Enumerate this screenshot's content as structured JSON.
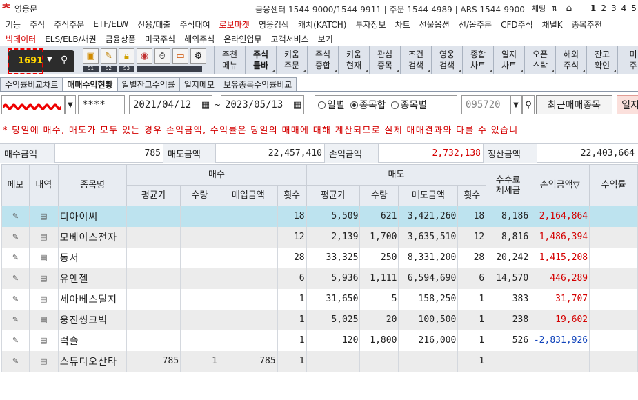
{
  "titlebar": {
    "app_name": "영웅문",
    "contacts": "금융센터 1544-9000/1544-9911 | 주문 1544-4989 | ARS 1544-9900",
    "chat_label": "채팅",
    "pages": [
      "1",
      "2",
      "3",
      "4",
      "5"
    ],
    "active_page": "1"
  },
  "menu_row1": [
    "기능",
    "주식",
    "주식주문",
    "ETF/ELW",
    "신용/대출",
    "주식대여",
    "로보마켓",
    "영웅검색",
    "캐치(KATCH)",
    "투자정보",
    "차트",
    "선물옵션",
    "선/옵주문",
    "CFD주식",
    "채널K",
    "종목추천"
  ],
  "menu_row1_red": [
    "로보마켓"
  ],
  "menu_row2": [
    "빅데이터",
    "ELS/ELB/채권",
    "금융상품",
    "미국주식",
    "해외주식",
    "온라인업무",
    "고객서비스",
    "보기"
  ],
  "menu_row2_red": [
    "빅데이터"
  ],
  "toolbar": {
    "screen_code": "1691",
    "slots": [
      "S1",
      "S2",
      "S3"
    ],
    "tools": [
      {
        "l1": "추천",
        "l2": "메뉴",
        "bold": false
      },
      {
        "l1": "주식",
        "l2": "툴바",
        "bold": true
      },
      {
        "l1": "키움",
        "l2": "주문",
        "bold": false
      },
      {
        "l1": "주식",
        "l2": "종합",
        "bold": false
      },
      {
        "l1": "키움",
        "l2": "현재",
        "bold": false
      },
      {
        "l1": "관심",
        "l2": "종목",
        "bold": false
      },
      {
        "l1": "조건",
        "l2": "검색",
        "bold": false
      },
      {
        "l1": "영웅",
        "l2": "검색",
        "bold": false
      },
      {
        "l1": "종합",
        "l2": "차트",
        "bold": false
      },
      {
        "l1": "일지",
        "l2": "차트",
        "bold": false
      },
      {
        "l1": "오픈",
        "l2": "스탁",
        "bold": false
      },
      {
        "l1": "해외",
        "l2": "주식",
        "bold": false
      },
      {
        "l1": "잔고",
        "l2": "확인",
        "bold": false
      },
      {
        "l1": "미",
        "l2": "주",
        "bold": false
      }
    ]
  },
  "tabs": [
    "수익률비교차트",
    "매매수익현황",
    "일별잔고수익률",
    "일지메모",
    "보유종목수익률비교"
  ],
  "active_tab": "매매수익현황",
  "filter": {
    "password": "****",
    "date_from": "2021/04/12",
    "date_to": "2023/05/13",
    "tilde": "~",
    "radios": [
      {
        "label": "일별",
        "on": false
      },
      {
        "label": "종목합",
        "on": true
      },
      {
        "label": "종목별",
        "on": false
      }
    ],
    "stock_code": "095720",
    "recent_button": "최근매매종목",
    "query_button": "일지"
  },
  "notice": "* 당일에 매수, 매도가 모두 있는 경우 손익금액, 수익률은 당일의 매매에 대해 계산되므로 실제 매매결과와 다를 수 있습니",
  "summary": {
    "buy_label": "매수금액",
    "buy_value": "785",
    "sell_label": "매도금액",
    "sell_value": "22,457,410",
    "pnl_label": "손익금액",
    "pnl_value": "2,732,138",
    "settle_label": "정산금액",
    "settle_value": "22,403,664"
  },
  "table": {
    "headers": {
      "memo": "메모",
      "detail": "내역",
      "name": "종목명",
      "buy_group": "매수",
      "sell_group": "매도",
      "buy_avg": "평균가",
      "buy_qty": "수량",
      "buy_amount": "매입금액",
      "buy_count": "횟수",
      "sell_avg": "평균가",
      "sell_qty": "수량",
      "sell_amount": "매도금액",
      "sell_count": "횟수",
      "fee_l1": "수수료",
      "fee_l2": "제세금",
      "pnl": "손익금액▽",
      "rate": "수익률"
    },
    "rows": [
      {
        "name": "디아이씨",
        "buy_avg": "",
        "buy_qty": "",
        "buy_amount": "",
        "buy_count": "18",
        "sell_avg": "5,509",
        "sell_qty": "621",
        "sell_amount": "3,421,260",
        "sell_count": "18",
        "fee": "8,186",
        "pnl": "2,164,864",
        "pnl_color": "red",
        "rate": ""
      },
      {
        "name": "모베이스전자",
        "buy_avg": "",
        "buy_qty": "",
        "buy_amount": "",
        "buy_count": "12",
        "sell_avg": "2,139",
        "sell_qty": "1,700",
        "sell_amount": "3,635,510",
        "sell_count": "12",
        "fee": "8,816",
        "pnl": "1,486,394",
        "pnl_color": "red",
        "rate": ""
      },
      {
        "name": "동서",
        "buy_avg": "",
        "buy_qty": "",
        "buy_amount": "",
        "buy_count": "28",
        "sell_avg": "33,325",
        "sell_qty": "250",
        "sell_amount": "8,331,200",
        "sell_count": "28",
        "fee": "20,242",
        "pnl": "1,415,208",
        "pnl_color": "red",
        "rate": ""
      },
      {
        "name": "유엔젤",
        "buy_avg": "",
        "buy_qty": "",
        "buy_amount": "",
        "buy_count": "6",
        "sell_avg": "5,936",
        "sell_qty": "1,111",
        "sell_amount": "6,594,690",
        "sell_count": "6",
        "fee": "14,570",
        "pnl": "446,289",
        "pnl_color": "red",
        "rate": ""
      },
      {
        "name": "세아베스틸지",
        "buy_avg": "",
        "buy_qty": "",
        "buy_amount": "",
        "buy_count": "1",
        "sell_avg": "31,650",
        "sell_qty": "5",
        "sell_amount": "158,250",
        "sell_count": "1",
        "fee": "383",
        "pnl": "31,707",
        "pnl_color": "red",
        "rate": ""
      },
      {
        "name": "웅진씽크빅",
        "buy_avg": "",
        "buy_qty": "",
        "buy_amount": "",
        "buy_count": "1",
        "sell_avg": "5,025",
        "sell_qty": "20",
        "sell_amount": "100,500",
        "sell_count": "1",
        "fee": "238",
        "pnl": "19,602",
        "pnl_color": "red",
        "rate": ""
      },
      {
        "name": "럭슬",
        "buy_avg": "",
        "buy_qty": "",
        "buy_amount": "",
        "buy_count": "1",
        "sell_avg": "120",
        "sell_qty": "1,800",
        "sell_amount": "216,000",
        "sell_count": "1",
        "fee": "526",
        "pnl": "-2,831,926",
        "pnl_color": "blue",
        "rate": ""
      },
      {
        "name": "스튜디오산타",
        "buy_avg": "785",
        "buy_qty": "1",
        "buy_amount": "785",
        "buy_count": "1",
        "sell_avg": "",
        "sell_qty": "",
        "sell_amount": "",
        "sell_count": "1",
        "fee": "",
        "pnl": "",
        "pnl_color": "red",
        "rate": ""
      }
    ]
  },
  "colors": {
    "accent_red": "#d40000",
    "loss_blue": "#1144bb",
    "selected_row": "#bde3ef",
    "toolbar_bg": "#dfe4ec"
  }
}
